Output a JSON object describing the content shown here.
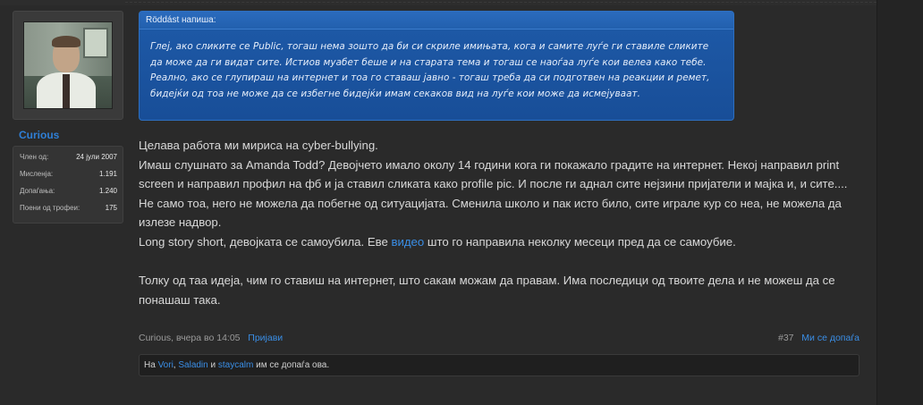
{
  "user": {
    "username": "Curious",
    "stats": [
      {
        "label": "Член од:",
        "value": "24 јули 2007"
      },
      {
        "label": "Мисленја:",
        "value": "1.191"
      },
      {
        "label": "Допаѓања:",
        "value": "1.240"
      },
      {
        "label": "Поени од трофеи:",
        "value": "175"
      }
    ]
  },
  "quote": {
    "header": "Röddást напиша:",
    "text": "Глеј, ако сликите се Public, тогаш нема зошто да би си скриле имињата, кога и самите луѓе ги ставиле сликите да може да ги видат сите. Истиов муабет беше и на старата тема и тогаш се наоѓаа луѓе кои велеа како тебе. Реално, ако се глупираш на интернет и тоа го ставаш јавно - тогаш треба да си подготвен на реакции и ремет, бидејќи од тоа не може да се избегне бидејќи имам секаков вид на луѓе кои може да исмејуваат."
  },
  "message": {
    "line1": "Целава работа ми мириса на cyber-bullying.",
    "para2": "Имаш слушнато за Amanda Todd? Девојчето имало околу 14 години кога ги покажало градите на интернет. Некој направил print screen и направил профил на фб и ја ставил сликата како profile pic. И после ги аднал сите нејзини пријатели и мајка и, и сите....",
    "para3": "Не само тоа, него не можела да побегне од ситуацијата. Сменила школо и пак исто било, сите играле кур со неа, не можела да излезе надвор.",
    "para4_before": "Long story short, девојката се самоубила. Еве ",
    "para4_link": "видео",
    "para4_after": " што го направила неколку месеци пред да се самоубие.",
    "para5": "Толку од таа идеја, чим го ставиш на интернет, што сакам можам да правам. Има последици од твоите дела и не можеш да се понашаш така."
  },
  "meta": {
    "author_time": "Curious, вчера во 14:05",
    "report_label": "Пријави",
    "post_number": "#37",
    "like_label": "Ми се допаѓа"
  },
  "likes": {
    "prefix": "На ",
    "user1": "Vori",
    "sep1": ", ",
    "user2": "Saladin",
    "sep2": " и ",
    "user3": "staycalm",
    "suffix": " им се допаѓа ова."
  }
}
